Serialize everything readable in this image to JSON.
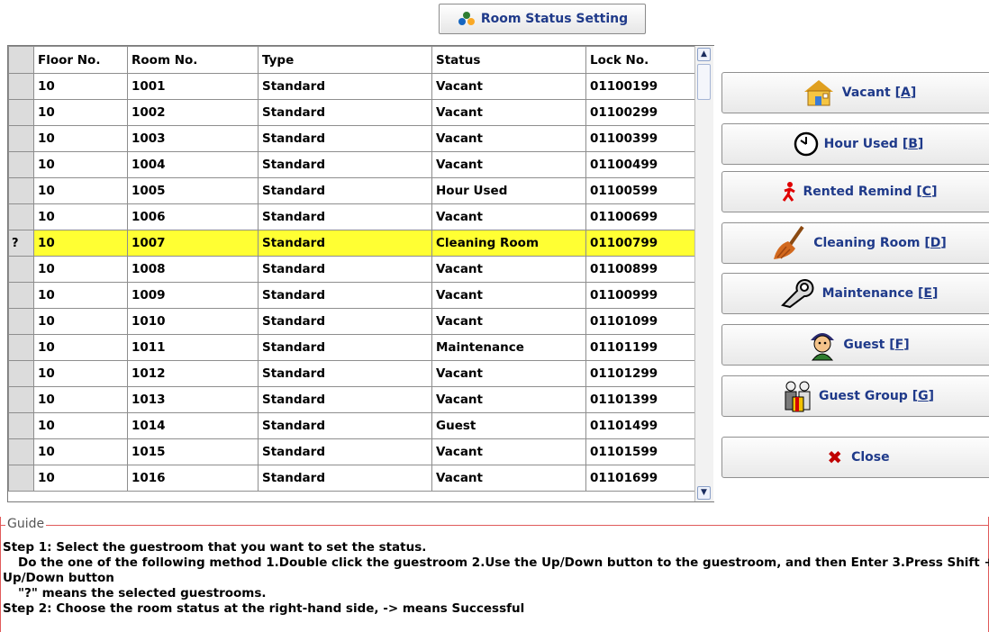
{
  "title_button": {
    "label": "Room Status Setting",
    "icon": "people-group-icon"
  },
  "grid": {
    "columns": [
      "Floor No.",
      "Room No.",
      "Type",
      "Status",
      "Lock No."
    ],
    "selected_marker": "?",
    "rows": [
      {
        "floor": "10",
        "room": "1001",
        "type": "Standard",
        "status": "Vacant",
        "lock": "01100199",
        "selected": false
      },
      {
        "floor": "10",
        "room": "1002",
        "type": "Standard",
        "status": "Vacant",
        "lock": "01100299",
        "selected": false
      },
      {
        "floor": "10",
        "room": "1003",
        "type": "Standard",
        "status": "Vacant",
        "lock": "01100399",
        "selected": false
      },
      {
        "floor": "10",
        "room": "1004",
        "type": "Standard",
        "status": "Vacant",
        "lock": "01100499",
        "selected": false
      },
      {
        "floor": "10",
        "room": "1005",
        "type": "Standard",
        "status": "Hour Used",
        "lock": "01100599",
        "selected": false
      },
      {
        "floor": "10",
        "room": "1006",
        "type": "Standard",
        "status": "Vacant",
        "lock": "01100699",
        "selected": false
      },
      {
        "floor": "10",
        "room": "1007",
        "type": "Standard",
        "status": "Cleaning Room",
        "lock": "01100799",
        "selected": true
      },
      {
        "floor": "10",
        "room": "1008",
        "type": "Standard",
        "status": "Vacant",
        "lock": "01100899",
        "selected": false
      },
      {
        "floor": "10",
        "room": "1009",
        "type": "Standard",
        "status": "Vacant",
        "lock": "01100999",
        "selected": false
      },
      {
        "floor": "10",
        "room": "1010",
        "type": "Standard",
        "status": "Vacant",
        "lock": "01101099",
        "selected": false
      },
      {
        "floor": "10",
        "room": "1011",
        "type": "Standard",
        "status": "Maintenance",
        "lock": "01101199",
        "selected": false
      },
      {
        "floor": "10",
        "room": "1012",
        "type": "Standard",
        "status": "Vacant",
        "lock": "01101299",
        "selected": false
      },
      {
        "floor": "10",
        "room": "1013",
        "type": "Standard",
        "status": "Vacant",
        "lock": "01101399",
        "selected": false
      },
      {
        "floor": "10",
        "room": "1014",
        "type": "Standard",
        "status": "Guest",
        "lock": "01101499",
        "selected": false
      },
      {
        "floor": "10",
        "room": "1015",
        "type": "Standard",
        "status": "Vacant",
        "lock": "01101599",
        "selected": false
      },
      {
        "floor": "10",
        "room": "1016",
        "type": "Standard",
        "status": "Vacant",
        "lock": "01101699",
        "selected": false
      }
    ]
  },
  "side_buttons": [
    {
      "name": "vacant-button",
      "label": "Vacant",
      "key": "A",
      "icon": "house-icon"
    },
    {
      "name": "hour-used-button",
      "label": "Hour Used",
      "key": "B",
      "icon": "clock-icon"
    },
    {
      "name": "rented-remind-button",
      "label": "Rented Remind",
      "key": "C",
      "icon": "running-man-icon"
    },
    {
      "name": "cleaning-room-button",
      "label": "Cleaning Room",
      "key": "D",
      "icon": "broom-icon"
    },
    {
      "name": "maintenance-button",
      "label": "Maintenance",
      "key": "E",
      "icon": "wrench-icon"
    },
    {
      "name": "guest-button",
      "label": "Guest",
      "key": "F",
      "icon": "guest-icon"
    },
    {
      "name": "guest-group-button",
      "label": "Guest Group",
      "key": "G",
      "icon": "guest-group-icon"
    },
    {
      "name": "close-button",
      "label": "Close",
      "key": "",
      "icon": "close-x-icon"
    }
  ],
  "guide": {
    "legend": "Guide",
    "lines": [
      "Step 1: Select the guestroom that you want to set the status.",
      "Do the one of the following method 1.Double click the guestroom 2.Use the Up/Down button to the guestroom, and then Enter 3.Press Shift +",
      "Up/Down button",
      "\"?\" means the selected guestrooms.",
      "Step 2: Choose the room status at the right-hand side, -> means Successful"
    ]
  },
  "colors": {
    "selected_row": "#ffff33",
    "button_text": "#1f3a8a",
    "guide_border": "#e05a5a"
  }
}
